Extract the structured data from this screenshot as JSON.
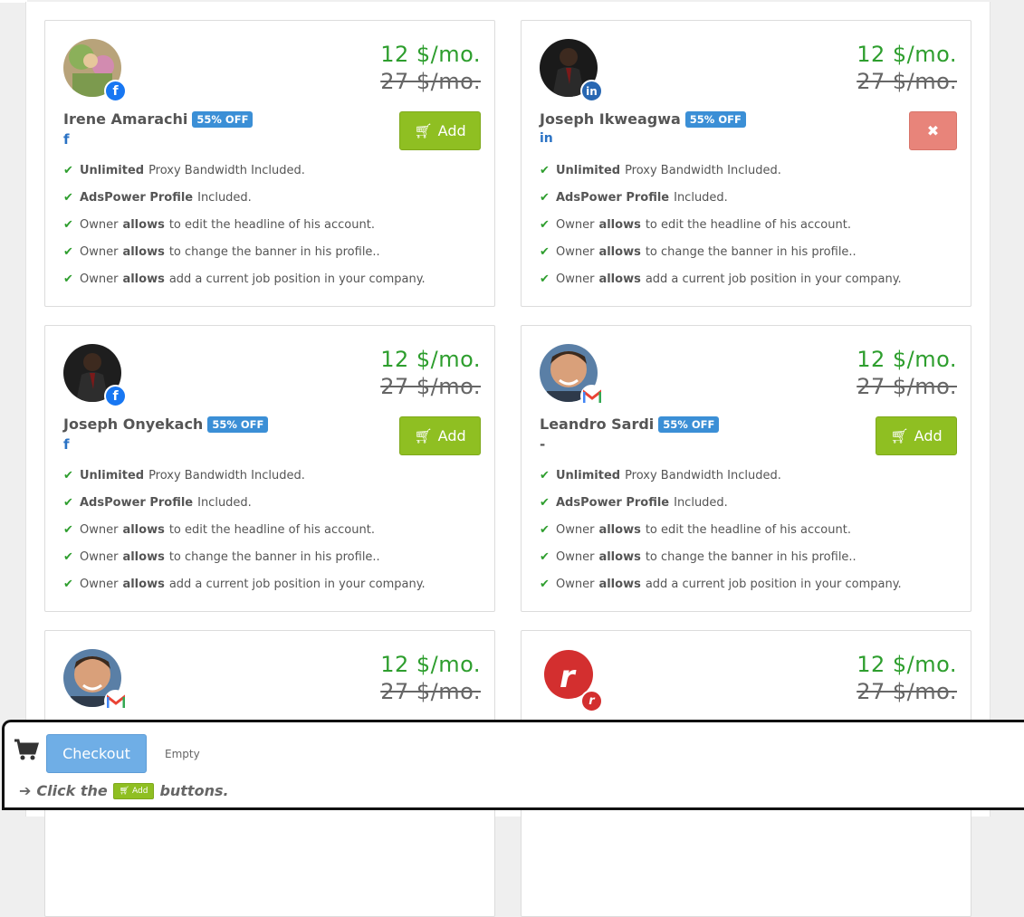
{
  "cards": [
    {
      "name": "Irene Amarachi",
      "discount": "55% OFF",
      "network": "f",
      "badge": "facebook",
      "price_now": "12 $/mo.",
      "price_was": "27 $/mo.",
      "action": "add",
      "action_label": "Add",
      "features": [
        {
          "bold": "Unlimited",
          "rest": " Proxy Bandwidth Included."
        },
        {
          "bold": "AdsPower Profile",
          "rest": " Included."
        },
        {
          "pre": "Owner ",
          "bold": "allows",
          "rest": " to edit the headline of his account."
        },
        {
          "pre": "Owner ",
          "bold": "allows",
          "rest": " to change the banner in his profile.."
        },
        {
          "pre": "Owner ",
          "bold": "allows",
          "rest": " add a current job position in your company."
        }
      ]
    },
    {
      "name": "Joseph Ikweagwa",
      "discount": "55% OFF",
      "network": "in",
      "badge": "linkedin",
      "price_now": "12 $/mo.",
      "price_was": "27 $/mo.",
      "action": "remove",
      "action_label": "✖",
      "features": [
        {
          "bold": "Unlimited",
          "rest": " Proxy Bandwidth Included."
        },
        {
          "bold": "AdsPower Profile",
          "rest": " Included."
        },
        {
          "pre": "Owner ",
          "bold": "allows",
          "rest": " to edit the headline of his account."
        },
        {
          "pre": "Owner ",
          "bold": "allows",
          "rest": " to change the banner in his profile.."
        },
        {
          "pre": "Owner ",
          "bold": "allows",
          "rest": " add a current job position in your company."
        }
      ]
    },
    {
      "name": "Joseph Onyekach",
      "discount": "55% OFF",
      "network": "f",
      "badge": "facebook",
      "price_now": "12 $/mo.",
      "price_was": "27 $/mo.",
      "action": "add",
      "action_label": "Add",
      "features": [
        {
          "bold": "Unlimited",
          "rest": " Proxy Bandwidth Included."
        },
        {
          "bold": "AdsPower Profile",
          "rest": " Included."
        },
        {
          "pre": "Owner ",
          "bold": "allows",
          "rest": " to edit the headline of his account."
        },
        {
          "pre": "Owner ",
          "bold": "allows",
          "rest": " to change the banner in his profile.."
        },
        {
          "pre": "Owner ",
          "bold": "allows",
          "rest": " add a current job position in your company."
        }
      ]
    },
    {
      "name": "Leandro Sardi",
      "discount": "55% OFF",
      "network": "-",
      "badge": "gmail",
      "price_now": "12 $/mo.",
      "price_was": "27 $/mo.",
      "action": "add",
      "action_label": "Add",
      "features": [
        {
          "bold": "Unlimited",
          "rest": " Proxy Bandwidth Included."
        },
        {
          "bold": "AdsPower Profile",
          "rest": " Included."
        },
        {
          "pre": "Owner ",
          "bold": "allows",
          "rest": " to edit the headline of his account."
        },
        {
          "pre": "Owner ",
          "bold": "allows",
          "rest": " to change the banner in his profile.."
        },
        {
          "pre": "Owner ",
          "bold": "allows",
          "rest": " add a current job position in your company."
        }
      ]
    },
    {
      "name": "",
      "badge": "gmail",
      "price_now": "12 $/mo.",
      "price_was": "27 $/mo."
    },
    {
      "name": "",
      "badge": "rambler",
      "price_now": "12 $/mo.",
      "price_was": "27 $/mo."
    }
  ],
  "cart": {
    "checkout_label": "Checkout",
    "status": "Empty",
    "hint_pre": "Click the",
    "hint_btn": "Add",
    "hint_post": "buttons."
  },
  "colors": {
    "price_green": "#2e9e2e",
    "add_green": "#8fbf22",
    "remove_red": "#e8847a",
    "discount_blue": "#3b8fd6",
    "checkout_blue": "#6faee6"
  }
}
